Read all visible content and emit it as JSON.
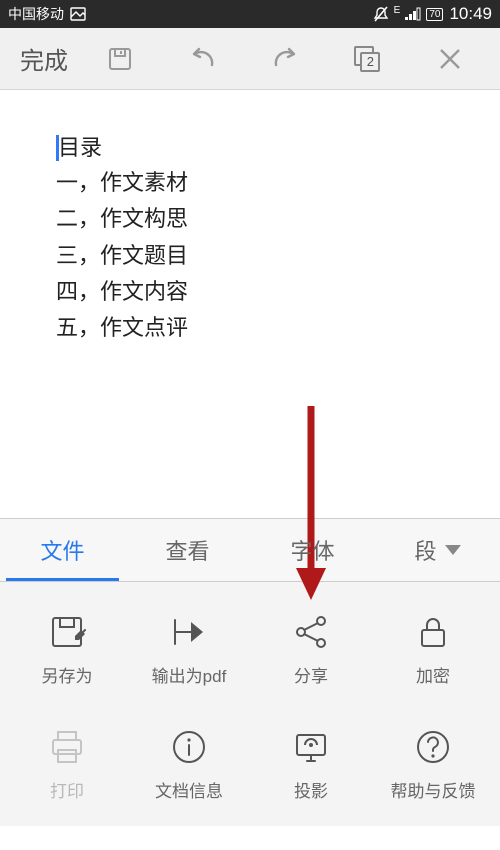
{
  "status_bar": {
    "carrier": "中国移动",
    "net": "E",
    "battery": "70",
    "time": "10:49"
  },
  "toolbar": {
    "done": "完成",
    "page_count": "2"
  },
  "document": {
    "title": "目录",
    "lines": [
      "一，作文素材",
      "二，作文构思",
      "三，作文题目",
      "四，作文内容",
      "五，作文点评"
    ]
  },
  "tabs": {
    "file": "文件",
    "view": "查看",
    "font": "字体",
    "paragraph": "段"
  },
  "actions": {
    "save_as": "另存为",
    "export_pdf": "输出为pdf",
    "share": "分享",
    "encrypt": "加密",
    "print": "打印",
    "doc_info": "文档信息",
    "project": "投影",
    "help": "帮助与反馈"
  }
}
